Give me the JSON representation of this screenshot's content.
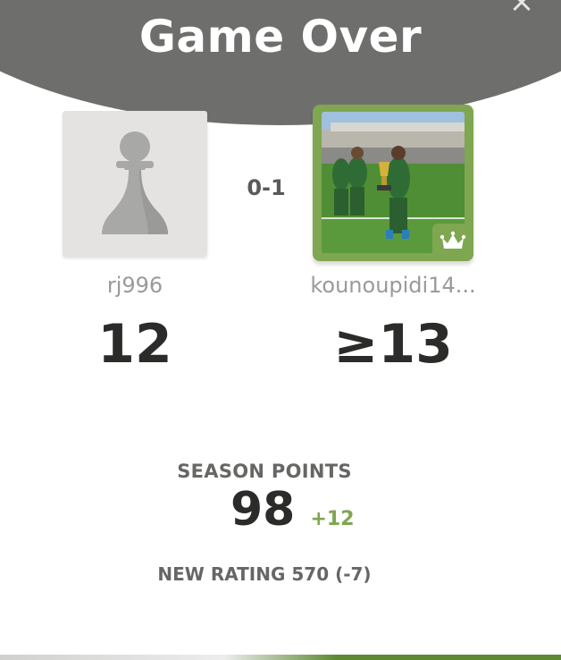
{
  "modal": {
    "title": "Game Over",
    "close_label": "×"
  },
  "players": {
    "left": {
      "username": "rj996",
      "score": "12",
      "avatar_icon": "pawn-icon"
    },
    "right": {
      "username": "kounoupidi14...",
      "score": "≥13",
      "avatar_icon": "player-photo",
      "badge_icon": "crown-icon",
      "is_winner": true
    }
  },
  "match": {
    "result": "0-1"
  },
  "season": {
    "label": "SEASON POINTS",
    "value": "98",
    "delta": "+12"
  },
  "rating": {
    "text": "NEW RATING 570 (-7)"
  },
  "colors": {
    "header_bg": "#6e6e6c",
    "winner_accent": "#7fa650",
    "text_dark": "#2b2b2a",
    "text_muted": "#9a9a98"
  }
}
